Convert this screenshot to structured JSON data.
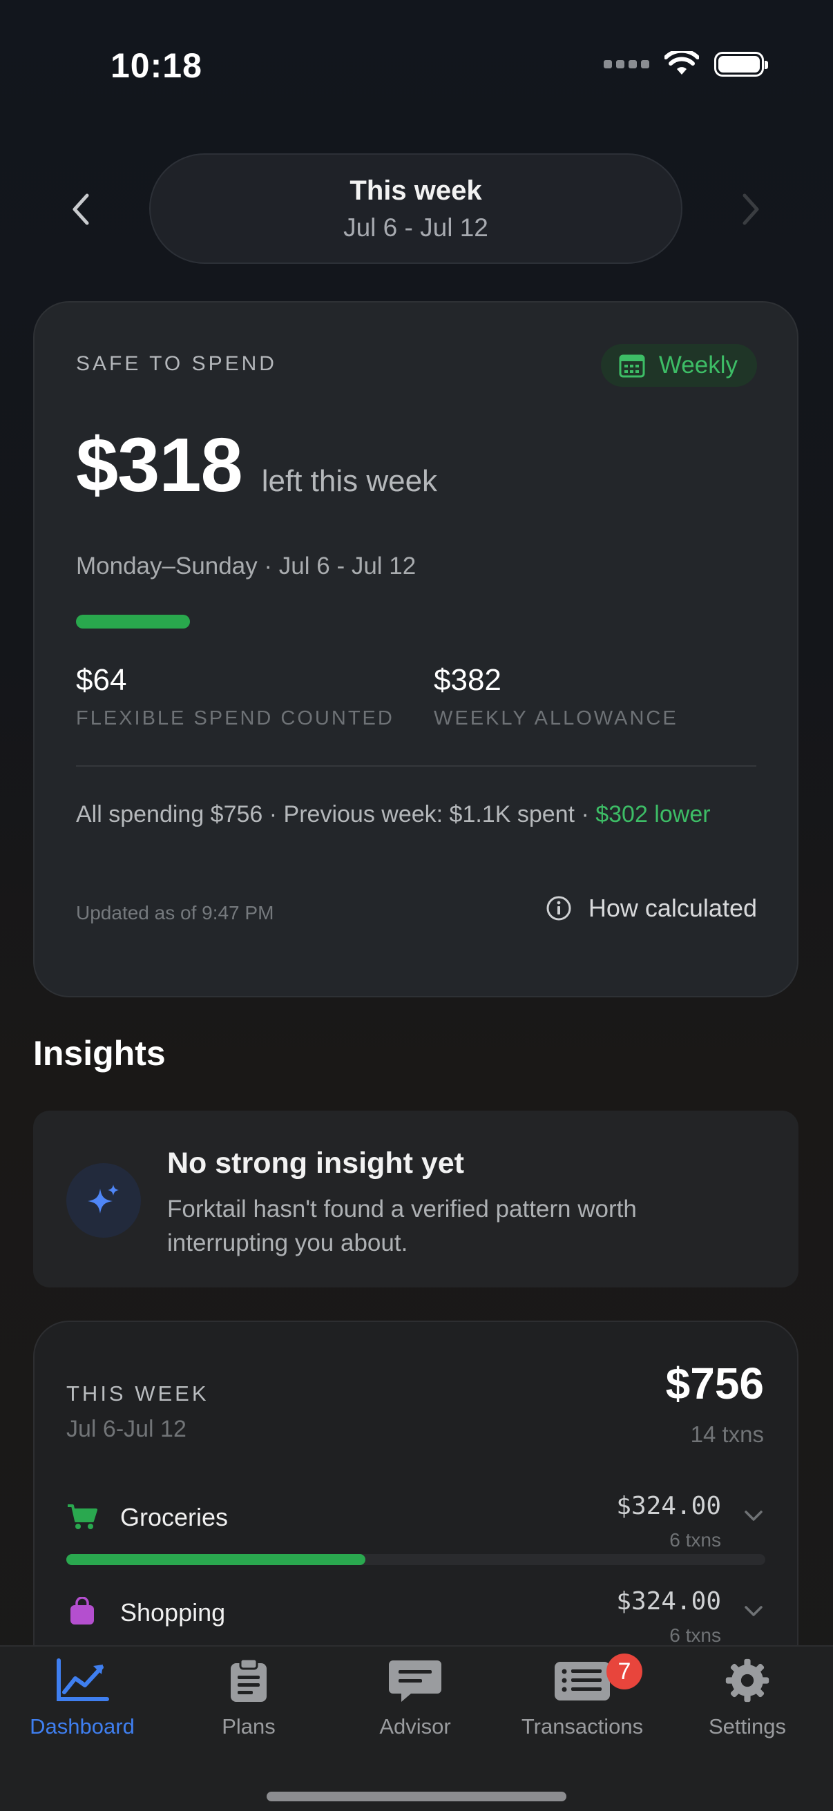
{
  "status_bar": {
    "time": "10:18"
  },
  "week_nav": {
    "title": "This week",
    "range": "Jul 6 - Jul 12"
  },
  "safe_to_spend": {
    "label": "SAFE TO SPEND",
    "period_badge": "Weekly",
    "amount": "$318",
    "amount_suffix": "left this week",
    "period_text": "Monday–Sunday · Jul 6 - Jul 12",
    "progress_fraction": 0.168,
    "flexible_value": "$64",
    "flexible_label": "FLEXIBLE SPEND COUNTED",
    "allowance_value": "$382",
    "allowance_label": "WEEKLY ALLOWANCE",
    "compare_text": "All spending $756 · Previous week: $1.1K spent · ",
    "compare_delta": "$302 lower",
    "updated": "Updated as of 9:47 PM",
    "how_calculated": "How calculated",
    "colors": {
      "accent_green": "#3dbd66",
      "bar_green": "#29a84d"
    }
  },
  "insights": {
    "section_title": "Insights",
    "card_title": "No strong insight yet",
    "card_body": "Forktail hasn't found a verified pattern worth interrupting you about."
  },
  "this_week": {
    "label": "THIS WEEK",
    "range": "Jul 6-Jul 12",
    "total": "$756",
    "txn_count": "14 txns",
    "categories": [
      {
        "name": "Groceries",
        "amount": "$324.00",
        "txns": "6 txns",
        "fraction": 0.428,
        "color": "#2aa84f",
        "icon": "cart-icon"
      },
      {
        "name": "Shopping",
        "amount": "$324.00",
        "txns": "6 txns",
        "fraction": 0.428,
        "color": "#b44fcf",
        "icon": "bag-icon"
      }
    ]
  },
  "tab_bar": {
    "tabs": [
      {
        "label": "Dashboard",
        "icon": "chart-line-icon",
        "active": true
      },
      {
        "label": "Plans",
        "icon": "clipboard-icon",
        "active": false
      },
      {
        "label": "Advisor",
        "icon": "chat-bubble-icon",
        "active": false
      },
      {
        "label": "Transactions",
        "icon": "list-icon",
        "active": false,
        "badge": "7"
      },
      {
        "label": "Settings",
        "icon": "gear-icon",
        "active": false
      }
    ],
    "active_color": "#3f7ff0"
  }
}
